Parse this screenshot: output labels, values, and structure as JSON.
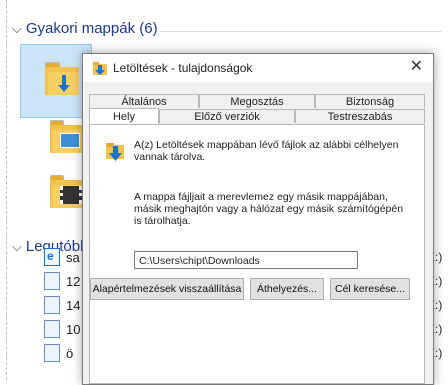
{
  "explorer": {
    "frequent_header": "Gyakori mappák (6)",
    "recent_header": "Legutóbb",
    "recent_items": [
      {
        "name": "sa",
        "drive": "E:)"
      },
      {
        "name": "12",
        "drive": "E:)"
      },
      {
        "name": "14",
        "drive": "E:)"
      },
      {
        "name": "10",
        "drive": "E:)"
      },
      {
        "name": "ö",
        "drive": "E:)"
      }
    ]
  },
  "dialog": {
    "title": "Letöltések - tulajdonságok",
    "close": "✕",
    "tabs_back": [
      "Általános",
      "Megosztás",
      "Biztonság"
    ],
    "tabs_front": [
      "Hely",
      "Előző verziók",
      "Testreszabás"
    ],
    "active_tab": "Hely",
    "info_text": "A(z) Letöltések mappában lévő fájlok az alábbi célhelyen vannak tárolva.",
    "move_text": "A mappa fájljait a merevlemez egy másik mappájában, másik meghajtón vagy a hálózat egy másik számítógépén is tárolhatja.",
    "path_value": "C:\\Users\\chipt\\Downloads",
    "buttons": {
      "restore": "Alapértelmezések visszaállítása",
      "move": "Áthelyezés...",
      "find_target": "Cél keresése..."
    }
  },
  "colors": {
    "selection": "#cce4f7",
    "folder": "#f2c14e",
    "download_arrow": "#1a73c9",
    "header_text": "#1e3a8a"
  }
}
